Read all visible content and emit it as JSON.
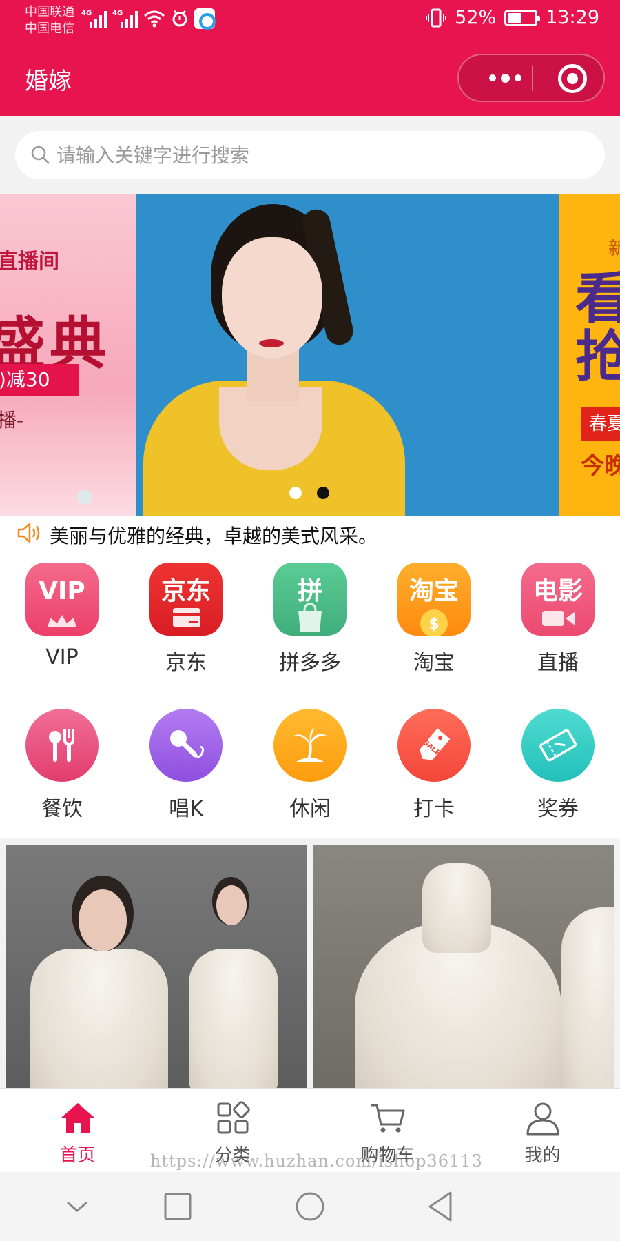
{
  "status_bar": {
    "carrier1": "中国联通",
    "carrier2": "中国电信",
    "network1": "4G",
    "network2": "4G",
    "battery_percent_text": "52%",
    "battery_level": 0.52,
    "time": "13:29"
  },
  "nav": {
    "title": "婚嫁",
    "accent_color": "#e8144f"
  },
  "search": {
    "placeholder": "请输入关键字进行搜索",
    "value": ""
  },
  "banner": {
    "left_slide": {
      "line1": "直播间",
      "line2": "盛典",
      "line3": ")减30",
      "line4": "播-"
    },
    "right_slide": {
      "line0": "新",
      "line1": "看\n抢",
      "line2": "春夏",
      "line3": "今晚"
    },
    "dot_count": 2,
    "active_dot": 1
  },
  "notice": {
    "text": "美丽与优雅的经典，卓越的美式风采。"
  },
  "grid": {
    "items": [
      {
        "label": "VIP",
        "icon_text": "VIP",
        "icon": "vip-icon",
        "color": "#f0557a"
      },
      {
        "label": "京东",
        "icon_text": "京东",
        "icon": "jd-icon",
        "color": "#e3242b"
      },
      {
        "label": "拼多多",
        "icon_text": "拼",
        "icon": "pinduoduo-icon",
        "color": "#4fbf8c"
      },
      {
        "label": "淘宝",
        "icon_text": "淘宝",
        "icon": "taobao-icon",
        "color": "#ff9a1f"
      },
      {
        "label": "直播",
        "icon_text": "电影",
        "icon": "live-icon",
        "color": "#f0557a"
      },
      {
        "label": "餐饮",
        "icon_text": "",
        "icon": "dining-icon",
        "color": "#ea4d7c"
      },
      {
        "label": "唱K",
        "icon_text": "",
        "icon": "microphone-icon",
        "color": "#a066e8"
      },
      {
        "label": "休闲",
        "icon_text": "",
        "icon": "palm-tree-icon",
        "color": "#ffab1d"
      },
      {
        "label": "打卡",
        "icon_text": "SALE",
        "icon": "tag-icon",
        "color": "#fb5a49"
      },
      {
        "label": "奖券",
        "icon_text": "",
        "icon": "ticket-icon",
        "color": "#33cfc6"
      }
    ]
  },
  "tabbar": {
    "items": [
      {
        "label": "首页",
        "icon": "home-icon",
        "active": true
      },
      {
        "label": "分类",
        "icon": "category-icon",
        "active": false
      },
      {
        "label": "购物车",
        "icon": "cart-icon",
        "active": false
      },
      {
        "label": "我的",
        "icon": "user-icon",
        "active": false
      }
    ]
  },
  "watermark": "https://www.huzhan.com/ishop36113"
}
